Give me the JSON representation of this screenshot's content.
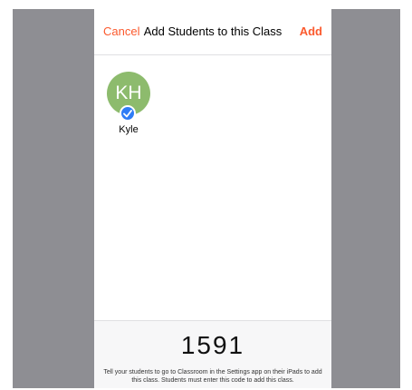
{
  "nav": {
    "cancel_label": "Cancel",
    "title": "Add Students to this Class",
    "add_label": "Add"
  },
  "student": {
    "initials": "KH",
    "name": "Kyle",
    "selected": true,
    "badge_icon": "checkmark-icon"
  },
  "code_panel": {
    "code": "1591",
    "instructions": "Tell your students to go to Classroom in the Settings app on their iPads to add this class. Students must enter this code to add this class."
  },
  "colors": {
    "accent": "#fb5a2e",
    "avatar": "#8dbb6d",
    "check_badge": "#2f7cf6",
    "backdrop": "#8e8e93"
  }
}
